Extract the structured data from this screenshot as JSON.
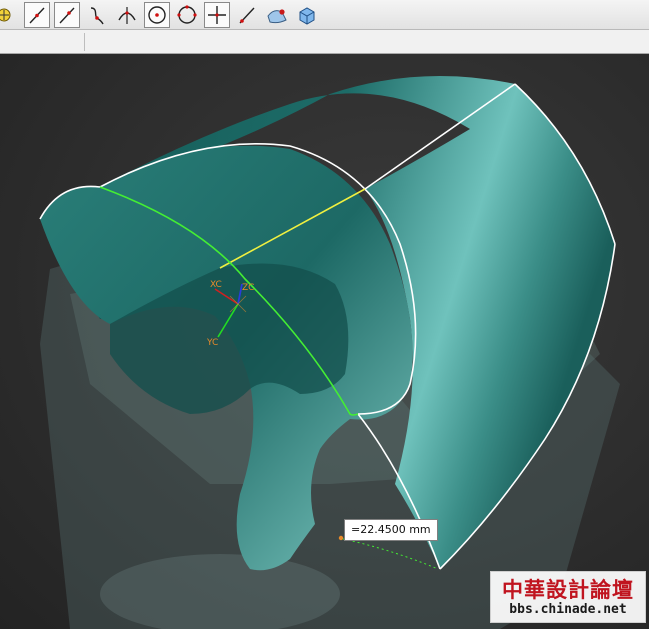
{
  "toolbar": {
    "items": [
      {
        "icon": "snap-point-icon"
      },
      {
        "icon": "line-icon",
        "selected": true
      },
      {
        "icon": "line-point-icon",
        "selected": true
      },
      {
        "icon": "curve-icon"
      },
      {
        "icon": "tangent-arc-icon"
      },
      {
        "icon": "circle-center-icon",
        "selected": true
      },
      {
        "icon": "circle-icon"
      },
      {
        "icon": "cross-point-icon",
        "selected": true
      },
      {
        "icon": "line-end-icon"
      },
      {
        "icon": "surface-icon"
      },
      {
        "icon": "solid-box-icon"
      }
    ]
  },
  "viewport": {
    "measurement_label": "=22.4500 mm",
    "csys": {
      "x": "XC",
      "y": "YC",
      "z": "ZC"
    }
  },
  "colors": {
    "surface": "#1e6e6a",
    "edge": "#ffffff",
    "green_curve": "#44ee33",
    "yellow_line": "#f0f040",
    "background": "#2f2f2f",
    "axis_label": "#e88a2a"
  },
  "watermark": {
    "chinese": "中華設計論壇",
    "url": "bbs.chinade.net"
  }
}
